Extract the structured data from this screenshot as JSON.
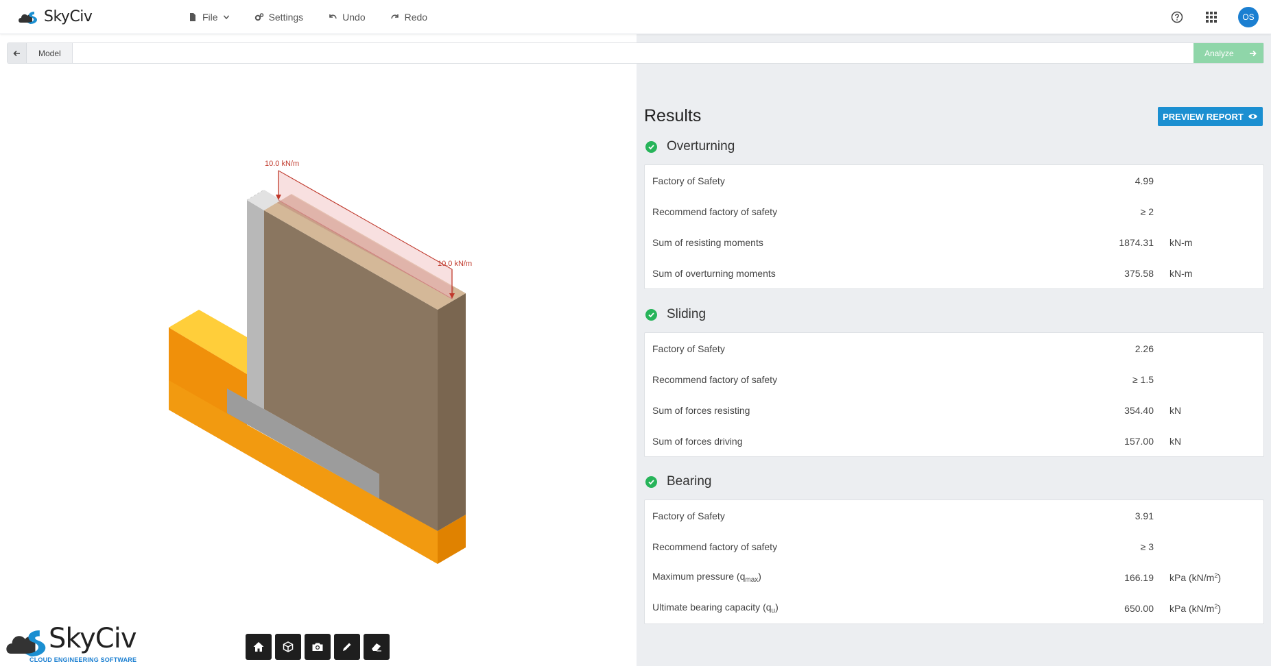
{
  "app": {
    "brand": "SkyCiv",
    "tagline": "CLOUD ENGINEERING SOFTWARE"
  },
  "menu": {
    "file": "File",
    "settings": "Settings",
    "undo": "Undo",
    "redo": "Redo"
  },
  "user": {
    "initials": "OS"
  },
  "breadcrumb": {
    "label": "Model",
    "analyze": "Analyze"
  },
  "model": {
    "load_left": "10.0 kN/m",
    "load_right": "10.0 kN/m"
  },
  "results": {
    "title": "Results",
    "preview_button": "PREVIEW REPORT",
    "overturning": {
      "title": "Overturning",
      "rows": [
        {
          "label": "Factory of Safety",
          "value": "4.99",
          "unit": ""
        },
        {
          "label": "Recommend factory of safety",
          "value": "≥ 2",
          "unit": ""
        },
        {
          "label": "Sum of resisting moments",
          "value": "1874.31",
          "unit": "kN-m"
        },
        {
          "label": "Sum of overturning moments",
          "value": "375.58",
          "unit": "kN-m"
        }
      ]
    },
    "sliding": {
      "title": "Sliding",
      "rows": [
        {
          "label": "Factory of Safety",
          "value": "2.26",
          "unit": ""
        },
        {
          "label": "Recommend factory of safety",
          "value": "≥ 1.5",
          "unit": ""
        },
        {
          "label": "Sum of forces resisting",
          "value": "354.40",
          "unit": "kN"
        },
        {
          "label": "Sum of forces driving",
          "value": "157.00",
          "unit": "kN"
        }
      ]
    },
    "bearing": {
      "title": "Bearing",
      "rows": [
        {
          "label": "Factory of Safety",
          "value": "3.91",
          "unit": ""
        },
        {
          "label": "Recommend factory of safety",
          "value": "≥ 3",
          "unit": ""
        },
        {
          "label": "Maximum pressure (q",
          "label_sub": "max",
          "label_end": ")",
          "value": "166.19",
          "unit": "kPa (kN/m",
          "unit_sup": "2",
          "unit_end": ")"
        },
        {
          "label": "Ultimate bearing capacity (q",
          "label_sub": "u",
          "label_end": ")",
          "value": "650.00",
          "unit": "kPa (kN/m",
          "unit_sup": "2",
          "unit_end": ")"
        }
      ]
    }
  },
  "colors": {
    "accent": "#1b8fd1",
    "success": "#27b45a",
    "analyze": "#8fd6a9",
    "soil": "#8a7560",
    "footing": "#f0900a",
    "footing_top": "#ffce3a",
    "stem": "#b5b5b5",
    "load": "#c0392b"
  }
}
